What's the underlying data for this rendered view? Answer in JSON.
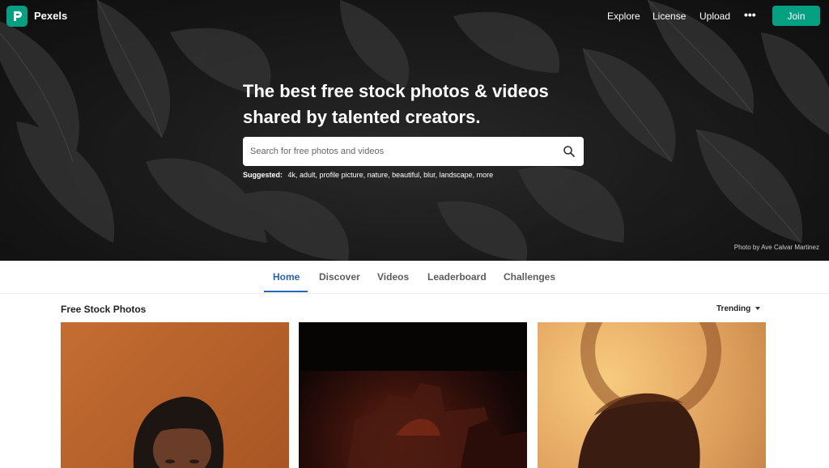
{
  "brand": {
    "name": "Pexels"
  },
  "nav": {
    "explore": "Explore",
    "license": "License",
    "upload": "Upload",
    "more": "•••",
    "join": "Join"
  },
  "hero": {
    "headline_1": "The best free stock photos & videos",
    "headline_2": "shared by talented creators.",
    "search_placeholder": "Search for free photos and videos",
    "suggested_label": "Suggested:",
    "suggested_terms": "4k, adult, profile picture, nature, beautiful, blur, landscape, more",
    "credit": "Photo by Ave Calvar Martinez"
  },
  "tabs": [
    "Home",
    "Discover",
    "Videos",
    "Leaderboard",
    "Challenges"
  ],
  "active_tab": "Home",
  "feed": {
    "title": "Free Stock Photos",
    "sort": "Trending"
  },
  "colors": {
    "accent": "#05a081",
    "tab_active": "#2a63b5"
  }
}
